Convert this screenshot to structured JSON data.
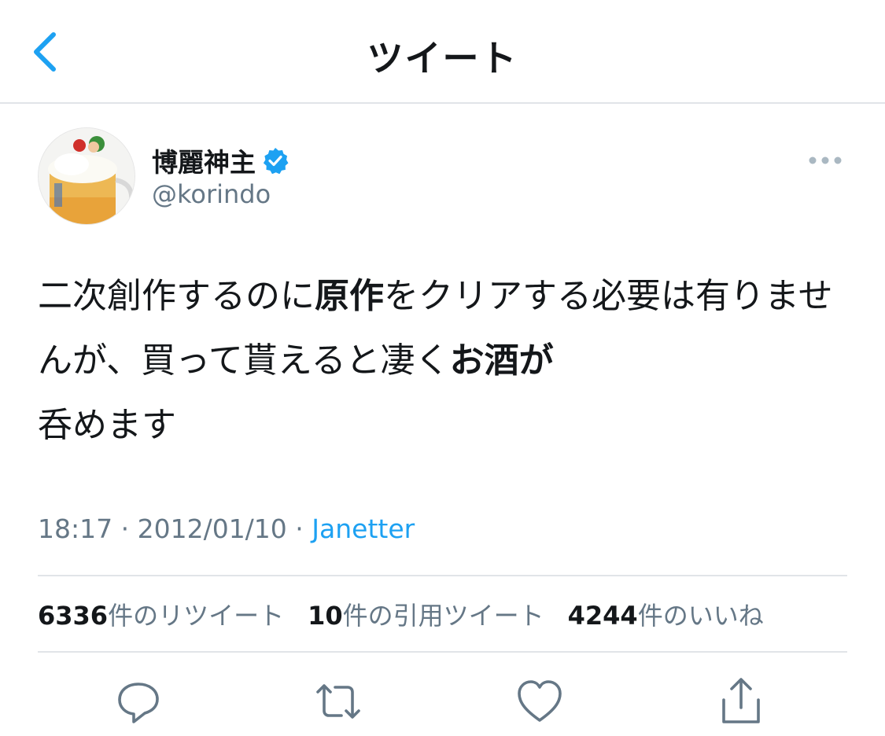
{
  "header": {
    "title": "ツイート",
    "back_icon": "chevron-left-icon"
  },
  "author": {
    "display_name": "博麗神主",
    "handle": "@korindo",
    "verified": true,
    "verified_icon": "verified-badge-icon",
    "avatar_icon": "beer-mug-avatar"
  },
  "tweet": {
    "segments": [
      {
        "text": "二次創作するのに",
        "bold": false
      },
      {
        "text": "原作",
        "bold": true
      },
      {
        "text": "をクリアする必要は有りませんが、買って貰えると凄く",
        "bold": false
      },
      {
        "text": "お酒が",
        "bold": true
      },
      {
        "text": "呑めます",
        "bold": false
      }
    ]
  },
  "meta": {
    "time": "18:17",
    "sep1": " · ",
    "date": "2012/01/10",
    "sep2": " · ",
    "source": "Janetter"
  },
  "stats": {
    "retweets": {
      "count": "6336",
      "label": "件のリツイート"
    },
    "quotes": {
      "count": "10",
      "label": "件の引用ツイート"
    },
    "likes": {
      "count": "4244",
      "label": "件のいいね"
    }
  },
  "actions": [
    "reply-icon",
    "retweet-icon",
    "like-icon",
    "share-icon"
  ],
  "colors": {
    "accent": "#1da1f2",
    "muted": "#657786",
    "text": "#14171a",
    "divider": "#e1e4e8"
  }
}
